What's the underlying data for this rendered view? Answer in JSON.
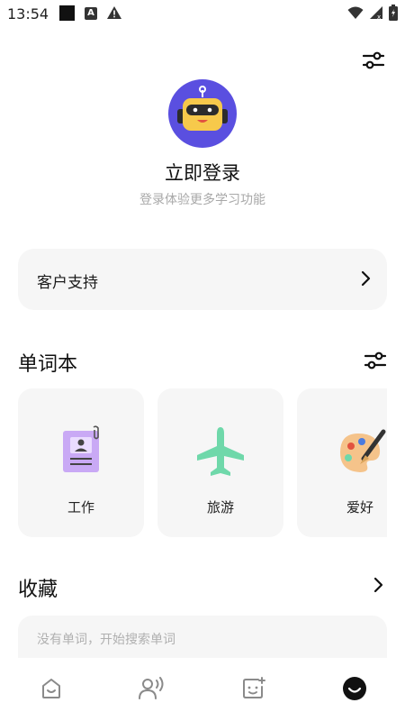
{
  "status_bar": {
    "time": "13:54",
    "icons": [
      "black-square",
      "a-box-icon",
      "warning-icon",
      "wifi-icon",
      "signal-icon",
      "battery-icon"
    ]
  },
  "header": {
    "settings_icon": "sliders-icon"
  },
  "profile": {
    "avatar_icon": "robot-icon",
    "login_title": "立即登录",
    "login_subtitle": "登录体验更多学习功能"
  },
  "support": {
    "label": "客户支持"
  },
  "vocab_books": {
    "title": "单词本",
    "items": [
      {
        "label": "工作",
        "icon": "badge-document-icon"
      },
      {
        "label": "旅游",
        "icon": "airplane-icon"
      },
      {
        "label": "爱好",
        "icon": "palette-icon"
      }
    ]
  },
  "favorites": {
    "title": "收藏",
    "empty_text": "没有单词，开始搜索单词"
  },
  "bottom_nav": {
    "items": [
      {
        "icon": "home-icon",
        "active": false
      },
      {
        "icon": "speak-icon",
        "active": false
      },
      {
        "icon": "flashcard-add-icon",
        "active": false
      },
      {
        "icon": "profile-smile-icon",
        "active": true
      }
    ]
  },
  "colors": {
    "accent": "#5a4fe0",
    "card_bg": "#f6f6f6",
    "subtext": "#a8a8a8"
  }
}
